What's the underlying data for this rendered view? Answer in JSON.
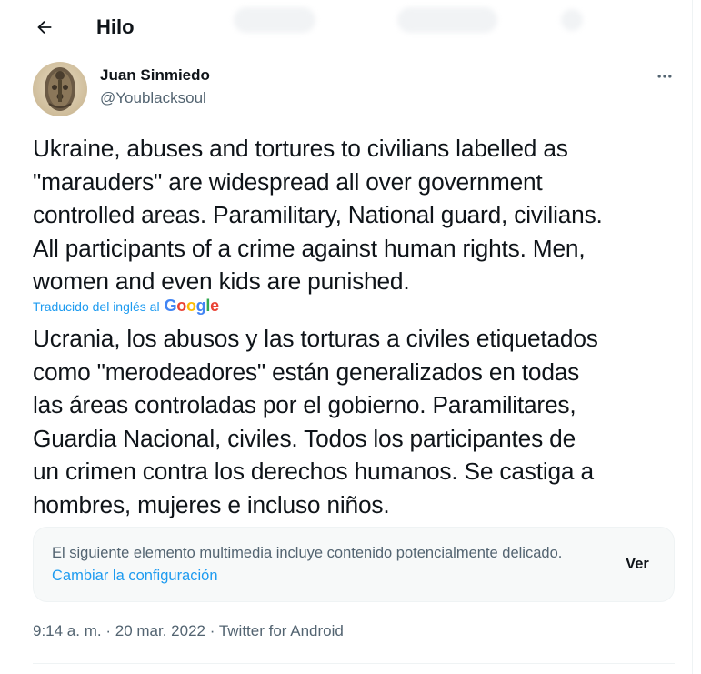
{
  "header": {
    "title": "Hilo"
  },
  "tweet": {
    "author_name": "Juan Sinmiedo",
    "author_handle": "@Youblacksoul",
    "text": "Ukraine, abuses and tortures to civilians labelled as\n\"marauders\" are widespread all over government\ncontrolled areas. Paramilitary, National guard, civilians.\nAll participants of a crime against human rights. Men,\nwomen and even kids are punished.",
    "translated_by_label": "Traducido del inglés al",
    "translation_provider": "Google",
    "translation": "Ucrania, los abusos y las torturas a civiles etiquetados\ncomo \"merodeadores\" están generalizados en todas\nlas áreas controladas por el gobierno. Paramilitares,\nGuardia Nacional, civiles. Todos los participantes de\nun crimen contra los derechos humanos. Se castiga a\nhombres, mujeres e incluso niños.",
    "sensitive_warning": "El siguiente elemento multimedia incluye contenido potencialmente delicado.",
    "change_settings_label": "Cambiar la configuración",
    "view_label": "Ver",
    "time": "9:14 a. m.",
    "date": "20 mar. 2022",
    "source": "Twitter for Android",
    "separator": "·"
  },
  "icons": {
    "back": "arrow-left-icon",
    "more": "more-horizontal-icon"
  },
  "colors": {
    "text": "#0f1419",
    "secondary": "#536471",
    "link": "#1d9bf0",
    "card_bg": "#f7f9f9"
  }
}
